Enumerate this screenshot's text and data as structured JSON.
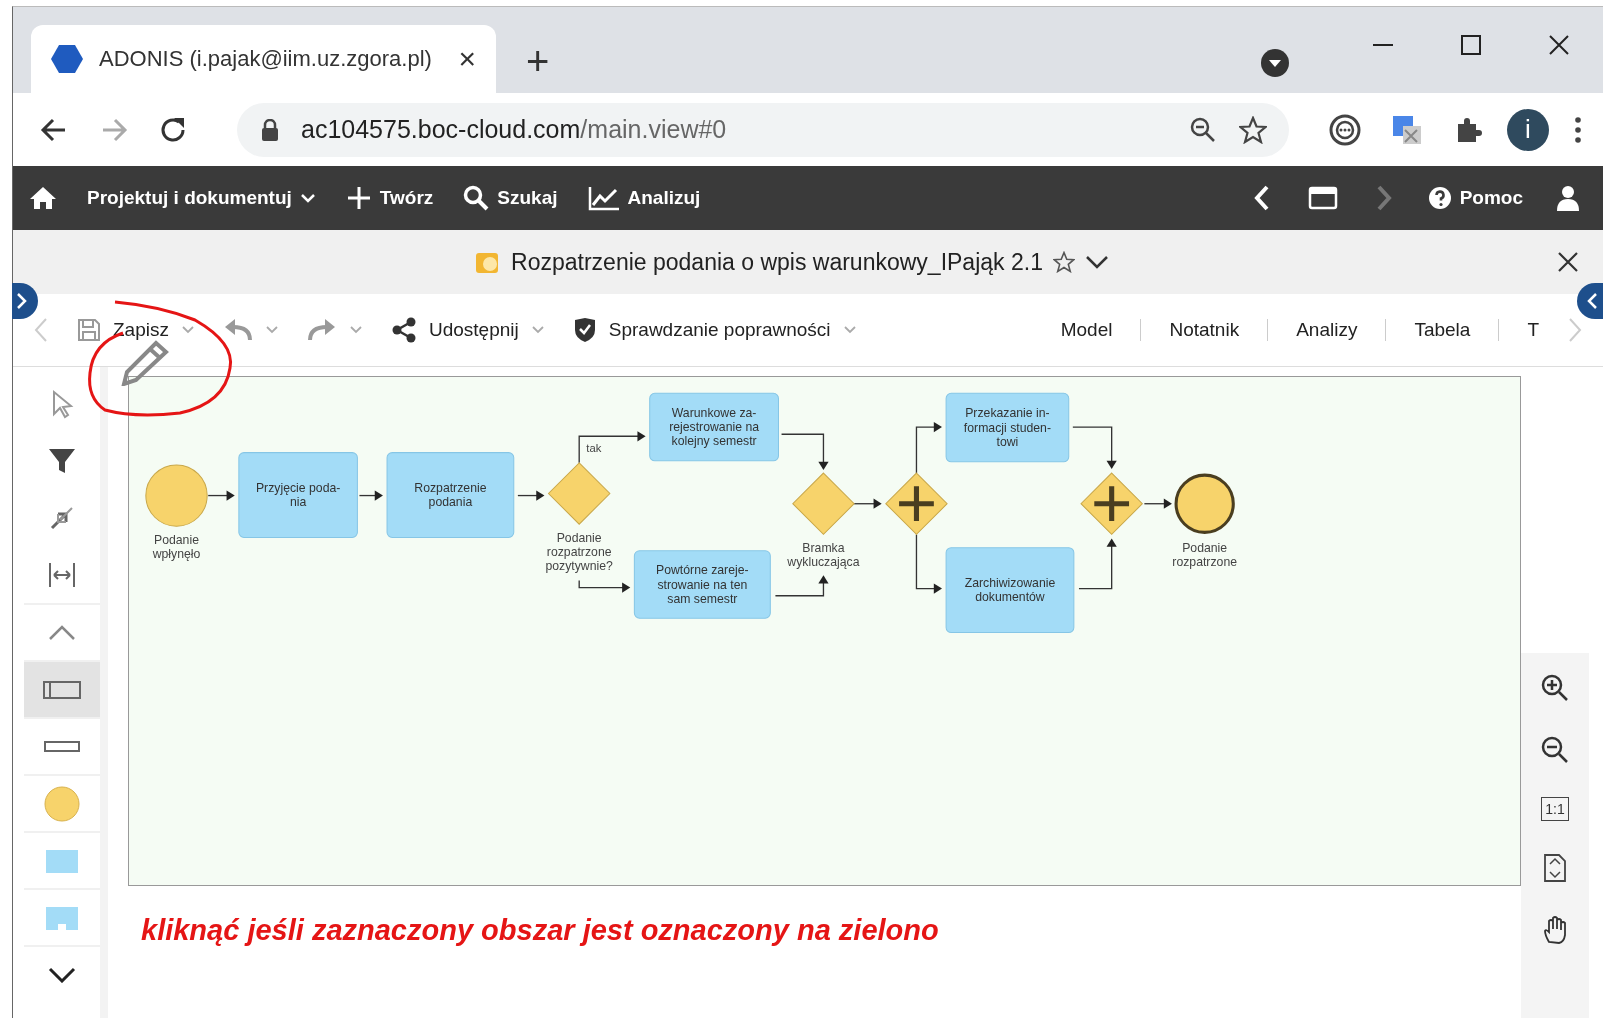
{
  "browser": {
    "tab": {
      "title": "ADONIS (i.pajak@iim.uz.zgora.pl)",
      "close": "×"
    },
    "new_tab": "+",
    "nav_buttons": [
      {
        "kind": "back",
        "disabled": false
      },
      {
        "kind": "forward",
        "disabled": true
      },
      {
        "kind": "reload",
        "disabled": false
      }
    ],
    "address": {
      "host": "ac104575.boc-cloud.com",
      "path": "/main.view#0"
    },
    "profile_initial": "i"
  },
  "app_nav": {
    "menu": [
      {
        "kind": "home"
      },
      {
        "kind": "dropdown",
        "label": "Projektuj i dokumentuj"
      },
      {
        "kind": "plus",
        "label": "Twórz"
      },
      {
        "kind": "search",
        "label": "Szukaj"
      },
      {
        "kind": "chart",
        "label": "Analizuj"
      }
    ],
    "right": [
      {
        "kind": "back",
        "disabled": false
      },
      {
        "kind": "window",
        "disabled": false
      },
      {
        "kind": "forward",
        "disabled": true
      },
      {
        "kind": "help",
        "label": "Pomoc",
        "disabled": false
      },
      {
        "kind": "user",
        "disabled": false
      }
    ]
  },
  "document": {
    "title": "Rozpatrzenie podania o wpis warunkowy_IPająk 2.1"
  },
  "toolbar": {
    "actions": [
      {
        "kind": "save",
        "label": "Zapisz"
      },
      {
        "kind": "undo"
      },
      {
        "kind": "redo"
      },
      {
        "kind": "share",
        "label": "Udostępnij"
      },
      {
        "kind": "check",
        "label": "Sprawdzanie poprawności"
      }
    ],
    "views": [
      "Model",
      "Notatnik",
      "Analizy",
      "Tabela",
      "T"
    ]
  },
  "left_tools": [
    {
      "kind": "pointer",
      "selected": false
    },
    {
      "kind": "filter",
      "selected": false
    },
    {
      "kind": "arrows",
      "selected": false
    },
    {
      "kind": "fit-width",
      "selected": false
    },
    {
      "kind": "chevron-up",
      "selected": false
    },
    {
      "kind": "wide-rect",
      "selected": true
    },
    {
      "kind": "flat-rect",
      "selected": false
    },
    {
      "kind": "circle",
      "selected": false
    },
    {
      "kind": "square",
      "selected": false
    },
    {
      "kind": "notched-square",
      "selected": false
    },
    {
      "kind": "chevron-down",
      "selected": false
    }
  ],
  "diagram": {
    "nodes": [
      {
        "kind": "start",
        "label": [
          "Podanie",
          "wpłynęło"
        ]
      },
      {
        "kind": "task",
        "label": [
          "Przyjęcie poda-",
          "nia"
        ]
      },
      {
        "kind": "task",
        "label": [
          "Rozpatrzenie",
          "podania"
        ]
      },
      {
        "kind": "gateway",
        "label": [
          "Podanie",
          "rozpatrzone",
          "pozytywnie?"
        ]
      },
      {
        "kind": "task",
        "label": [
          "Warunkowe za-",
          "rejestrowanie na",
          "kolejny semestr"
        ]
      },
      {
        "kind": "task",
        "label": [
          "Powtórne zareje-",
          "strowanie na ten",
          "sam semestr"
        ]
      },
      {
        "kind": "gateway",
        "label": [
          "Bramka",
          "wykluczająca"
        ]
      },
      {
        "kind": "parallel"
      },
      {
        "kind": "task",
        "label": [
          "Przekazanie in-",
          "formacji studen-",
          "towi"
        ]
      },
      {
        "kind": "task",
        "label": [
          "Zarchiwizowanie",
          "dokumentów"
        ]
      },
      {
        "kind": "parallel"
      },
      {
        "kind": "end",
        "label": [
          "Podanie",
          "rozpatrzone"
        ]
      }
    ],
    "edge_label": "tak"
  },
  "zoom_tools": [
    {
      "kind": "zoom-in"
    },
    {
      "kind": "zoom-out"
    },
    {
      "kind": "actual-size",
      "label": "1:1"
    },
    {
      "kind": "fit-page"
    },
    {
      "kind": "hand"
    }
  ],
  "annotation": {
    "text": "kliknąć jeśli zaznaczony obszar jest oznaczony na zielono"
  }
}
